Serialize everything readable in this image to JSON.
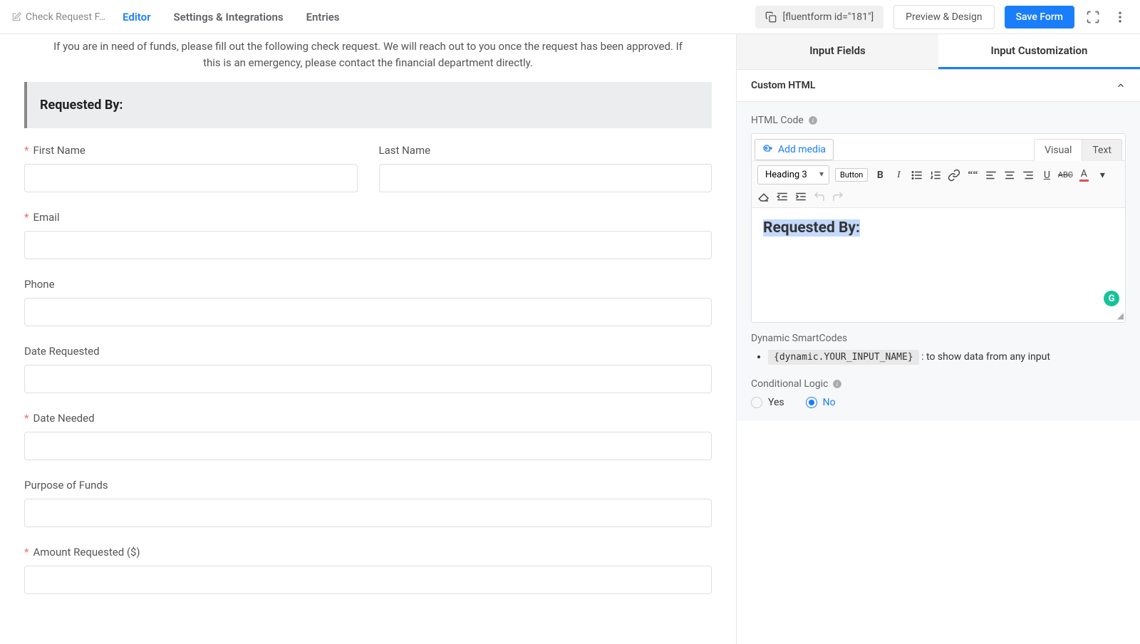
{
  "topbar": {
    "formTitle": "Check Request F…",
    "tabs": [
      "Editor",
      "Settings & Integrations",
      "Entries"
    ],
    "activeTab": "Editor",
    "shortcode": "[fluentform id=\"181\"]",
    "previewBtn": "Preview & Design",
    "saveBtn": "Save Form"
  },
  "form": {
    "intro": "If you are in need of funds, please fill out the following check request. We will reach out to you once the request has been approved. If this is an emergency, please contact the financial department directly.",
    "sectionTitle": "Requested By:",
    "fields": {
      "firstName": {
        "label": "First Name",
        "required": true
      },
      "lastName": {
        "label": "Last Name",
        "required": false
      },
      "email": {
        "label": "Email",
        "required": true
      },
      "phone": {
        "label": "Phone",
        "required": false
      },
      "dateRequested": {
        "label": "Date Requested",
        "required": false
      },
      "dateNeeded": {
        "label": "Date Needed",
        "required": true
      },
      "purpose": {
        "label": "Purpose of Funds",
        "required": false
      },
      "amount": {
        "label": "Amount Requested ($)",
        "required": true
      }
    }
  },
  "sidebar": {
    "tabs": [
      "Input Fields",
      "Input Customization"
    ],
    "activeTab": "Input Customization",
    "panelTitle": "Custom HTML",
    "htmlCodeLabel": "HTML Code",
    "addMedia": "Add media",
    "rteTabs": {
      "visual": "Visual",
      "text": "Text"
    },
    "formatSelect": "Heading 3",
    "buttonTag": "Button",
    "rteContent": "Requested By:",
    "smartcodesLabel": "Dynamic SmartCodes",
    "smartcodeExample": "{dynamic.YOUR_INPUT_NAME}",
    "smartcodeDesc": " : to show data from any input",
    "conditionalLabel": "Conditional Logic",
    "radioYes": "Yes",
    "radioNo": "No",
    "radioValue": "No"
  }
}
